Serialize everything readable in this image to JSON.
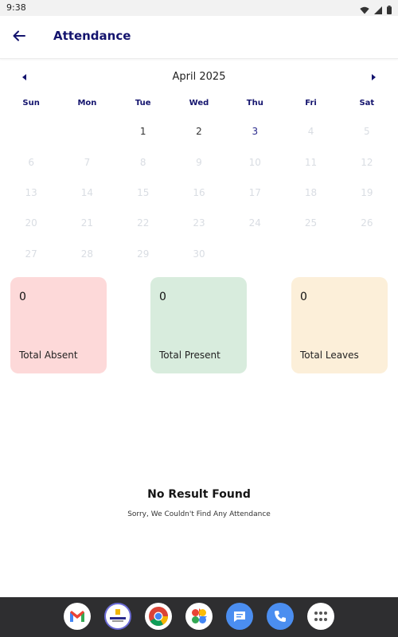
{
  "status_bar": {
    "time": "9:38"
  },
  "header": {
    "title": "Attendance"
  },
  "calendar": {
    "month_label": "April 2025",
    "weekdays": [
      "Sun",
      "Mon",
      "Tue",
      "Wed",
      "Thu",
      "Fri",
      "Sat"
    ],
    "days": [
      {
        "label": "",
        "state": "empty"
      },
      {
        "label": "",
        "state": "empty"
      },
      {
        "label": "1",
        "state": "active"
      },
      {
        "label": "2",
        "state": "active"
      },
      {
        "label": "3",
        "state": "today"
      },
      {
        "label": "4",
        "state": "future"
      },
      {
        "label": "5",
        "state": "future"
      },
      {
        "label": "6",
        "state": "future"
      },
      {
        "label": "7",
        "state": "future"
      },
      {
        "label": "8",
        "state": "future"
      },
      {
        "label": "9",
        "state": "future"
      },
      {
        "label": "10",
        "state": "future"
      },
      {
        "label": "11",
        "state": "future"
      },
      {
        "label": "12",
        "state": "future"
      },
      {
        "label": "13",
        "state": "future"
      },
      {
        "label": "14",
        "state": "future"
      },
      {
        "label": "15",
        "state": "future"
      },
      {
        "label": "16",
        "state": "future"
      },
      {
        "label": "17",
        "state": "future"
      },
      {
        "label": "18",
        "state": "future"
      },
      {
        "label": "19",
        "state": "future"
      },
      {
        "label": "20",
        "state": "future"
      },
      {
        "label": "21",
        "state": "future"
      },
      {
        "label": "22",
        "state": "future"
      },
      {
        "label": "23",
        "state": "future"
      },
      {
        "label": "24",
        "state": "future"
      },
      {
        "label": "25",
        "state": "future"
      },
      {
        "label": "26",
        "state": "future"
      },
      {
        "label": "27",
        "state": "future"
      },
      {
        "label": "28",
        "state": "future"
      },
      {
        "label": "29",
        "state": "future"
      },
      {
        "label": "30",
        "state": "future"
      }
    ]
  },
  "summary": {
    "absent": {
      "value": "0",
      "label": "Total Absent",
      "color": "#fdd9d9"
    },
    "present": {
      "value": "0",
      "label": "Total Present",
      "color": "#d8ecdd"
    },
    "leaves": {
      "value": "0",
      "label": "Total Leaves",
      "color": "#fcefd9"
    }
  },
  "empty_state": {
    "title": "No Result Found",
    "message": "Sorry, We Couldn't Find Any Attendance"
  },
  "dock": {
    "apps": [
      "gmail-icon",
      "school-app-icon",
      "chrome-icon",
      "photos-icon",
      "messages-icon",
      "phone-icon",
      "app-drawer-icon"
    ]
  },
  "colors": {
    "accent": "#14146e",
    "today": "#2a2a8c"
  }
}
